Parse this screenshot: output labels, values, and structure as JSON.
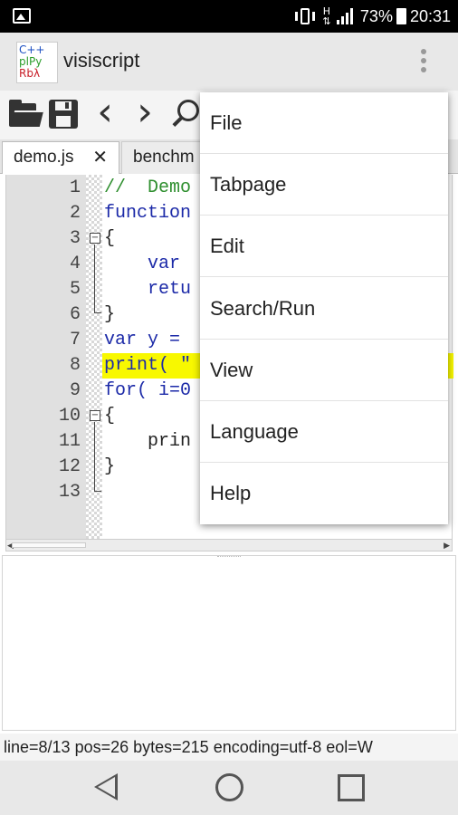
{
  "status_bar": {
    "battery": "73%",
    "time": "20:31"
  },
  "app": {
    "title": "visiscript",
    "logo_lines": [
      "C++",
      "plPy",
      "Rbλ"
    ]
  },
  "toolbar": {
    "icons": [
      "folder-icon",
      "save-icon",
      "back-icon",
      "forward-icon",
      "search-icon"
    ]
  },
  "tabs": [
    {
      "label": "demo.js",
      "active": true,
      "close": "✕"
    },
    {
      "label": "benchm",
      "active": false
    }
  ],
  "editor": {
    "lines": [
      {
        "num": "1",
        "code": "//  Demo"
      },
      {
        "num": "2",
        "code": "function"
      },
      {
        "num": "3",
        "code": "{"
      },
      {
        "num": "4",
        "code": "    var"
      },
      {
        "num": "5",
        "code": "    retu"
      },
      {
        "num": "6",
        "code": "}"
      },
      {
        "num": "7",
        "code": "var y ="
      },
      {
        "num": "8",
        "code": "print( \""
      },
      {
        "num": "9",
        "code": "for( i=0"
      },
      {
        "num": "10",
        "code": "{"
      },
      {
        "num": "11",
        "code": "    prin"
      },
      {
        "num": "12",
        "code": "}"
      },
      {
        "num": "13",
        "code": ""
      }
    ],
    "highlight_color": "#f8f800"
  },
  "statusline": {
    "text": "line=8/13 pos=26 bytes=215 encoding=utf-8 eol=W"
  },
  "menu": {
    "items": [
      "File",
      "Tabpage",
      "Edit",
      "Search/Run",
      "View",
      "Language",
      "Help"
    ]
  },
  "navbar": {
    "icons": [
      "back-triangle-icon",
      "home-circle-icon",
      "recents-square-icon"
    ]
  }
}
